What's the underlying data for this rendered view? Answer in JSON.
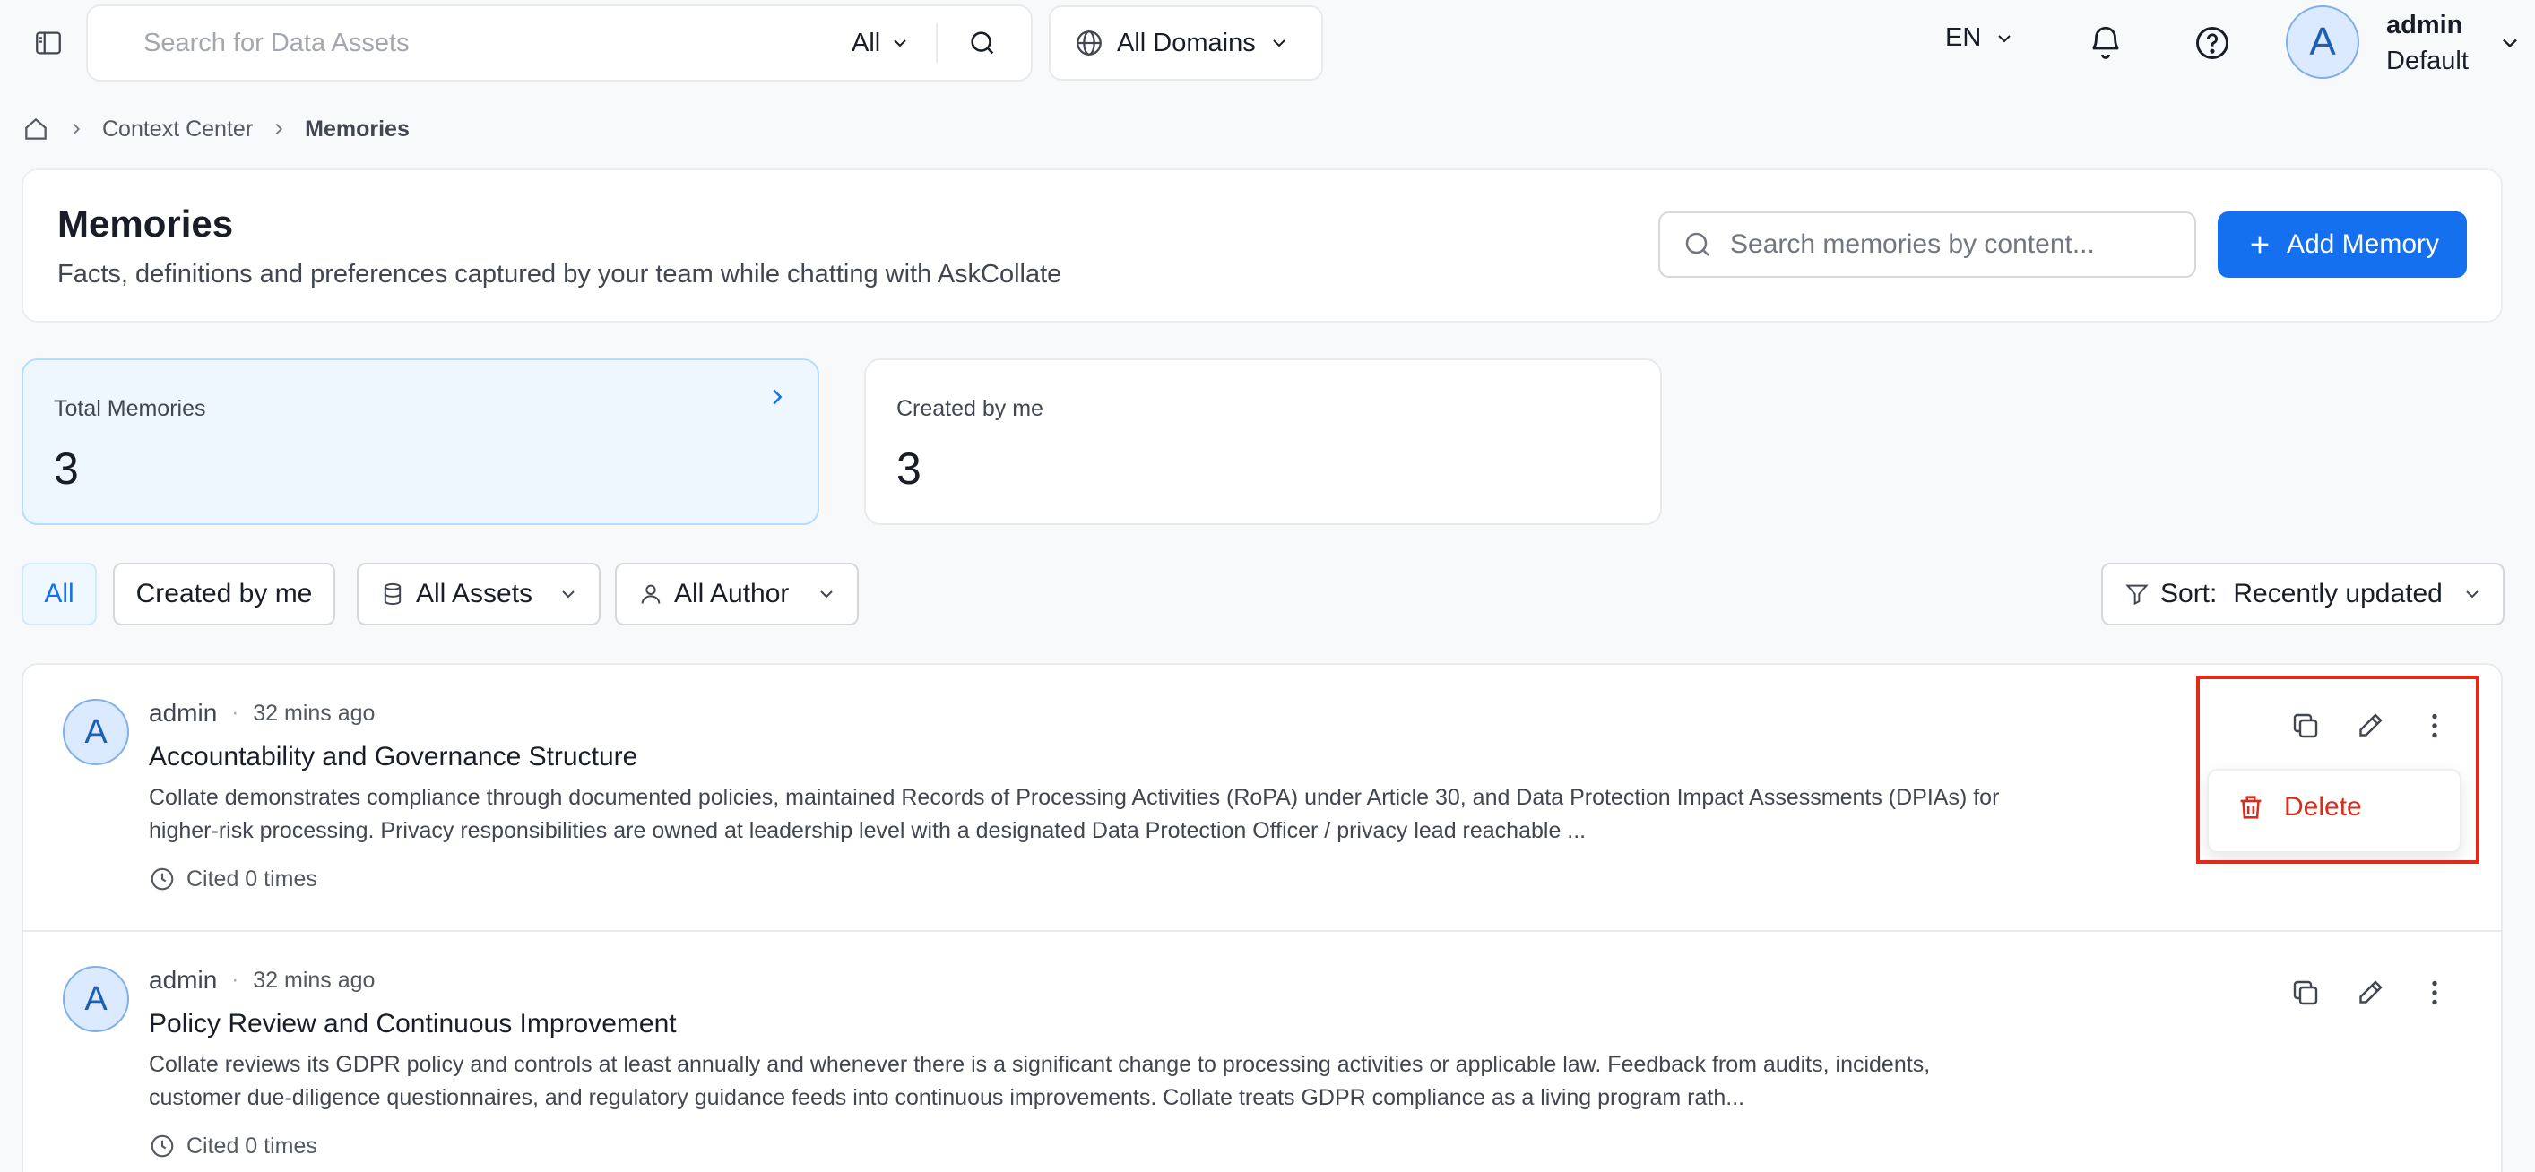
{
  "topbar": {
    "search_placeholder": "Search for Data Assets",
    "search_type": "All",
    "domain": "All Domains",
    "language": "EN",
    "user": {
      "initial": "A",
      "name": "admin",
      "role": "Default"
    }
  },
  "breadcrumb": {
    "items": [
      "Context Center"
    ],
    "current": "Memories"
  },
  "header": {
    "title": "Memories",
    "subtitle": "Facts, definitions and preferences captured by your team while chatting with AskCollate",
    "search_placeholder": "Search memories by content...",
    "add_button": "Add Memory"
  },
  "stats": [
    {
      "label": "Total Memories",
      "value": "3"
    },
    {
      "label": "Created by me",
      "value": "3"
    }
  ],
  "filters": {
    "all": "All",
    "created_by_me": "Created by me",
    "assets": "All Assets",
    "author": "All Author",
    "sort_label": "Sort:",
    "sort_value": "Recently updated"
  },
  "memories": [
    {
      "initial": "A",
      "author": "admin",
      "separator": "·",
      "time": "32 mins ago",
      "title": "Accountability and Governance Structure",
      "body": "Collate demonstrates compliance through documented policies, maintained Records of Processing Activities (RoPA) under Article 30, and Data Protection Impact Assessments (DPIAs) for higher-risk processing. Privacy responsibilities are owned at leadership level with a designated Data Protection Officer / privacy lead reachable ...",
      "cited": "Cited 0 times"
    },
    {
      "initial": "A",
      "author": "admin",
      "separator": "·",
      "time": "32 mins ago",
      "title": "Policy Review and Continuous Improvement",
      "body": "Collate reviews its GDPR policy and controls at least annually and whenever there is a significant change to processing activities or applicable law. Feedback from audits, incidents, customer due-diligence questionnaires, and regulatory guidance feeds into continuous improvements. Collate treats GDPR compliance as a living program rath...",
      "cited": "Cited 0 times"
    }
  ],
  "action_menu": {
    "delete": "Delete"
  },
  "colors": {
    "primary": "#1570ef",
    "danger": "#d92d20",
    "highlight": "#e02a1a"
  }
}
